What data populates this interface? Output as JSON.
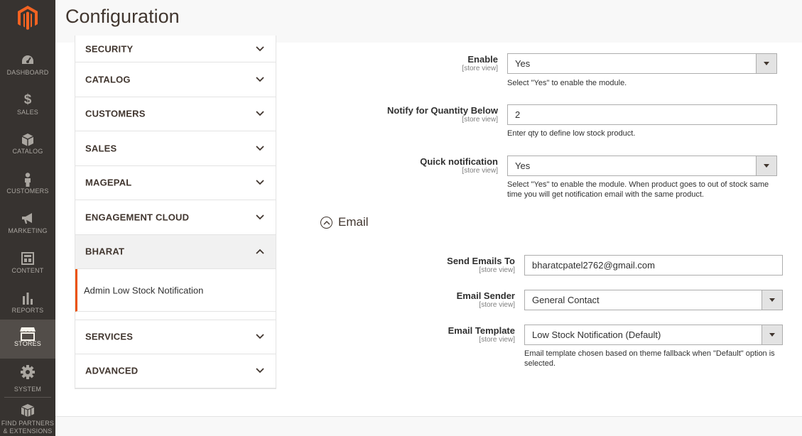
{
  "header": {
    "title": "Configuration"
  },
  "nav": {
    "items": [
      {
        "label": "DASHBOARD",
        "icon": "dashboard-icon"
      },
      {
        "label": "SALES",
        "icon": "dollar-icon"
      },
      {
        "label": "CATALOG",
        "icon": "box-icon"
      },
      {
        "label": "CUSTOMERS",
        "icon": "person-icon"
      },
      {
        "label": "MARKETING",
        "icon": "megaphone-icon"
      },
      {
        "label": "CONTENT",
        "icon": "layout-icon"
      },
      {
        "label": "REPORTS",
        "icon": "bar-chart-icon"
      },
      {
        "label": "STORES",
        "icon": "store-icon"
      },
      {
        "label": "SYSTEM",
        "icon": "gear-icon"
      },
      {
        "label": "FIND PARTNERS & EXTENSIONS",
        "icon": "cubes-icon"
      }
    ],
    "active": "STORES"
  },
  "tabs": {
    "items": [
      "SECURITY",
      "CATALOG",
      "CUSTOMERS",
      "SALES",
      "MAGEPAL",
      "ENGAGEMENT CLOUD",
      "BHARAT",
      "SERVICES",
      "ADVANCED"
    ],
    "open": "BHARAT",
    "sub_item": "Admin Low Stock Notification"
  },
  "form": {
    "scope_label": "[store view]",
    "enable": {
      "label": "Enable",
      "value": "Yes",
      "note": "Select \"Yes\" to enable the module."
    },
    "notify_qty": {
      "label": "Notify for Quantity Below",
      "value": "2",
      "note": "Enter qty to define low stock product."
    },
    "quick_notification": {
      "label": "Quick notification",
      "value": "Yes",
      "note": "Select \"Yes\" to enable the module. When product goes to out of stock same time you will get notification email with the same product."
    },
    "email_section": {
      "title": "Email",
      "state": "expanded"
    },
    "send_emails_to": {
      "label": "Send Emails To",
      "value": "bharatcpatel2762@gmail.com"
    },
    "email_sender": {
      "label": "Email Sender",
      "value": "General Contact"
    },
    "email_template": {
      "label": "Email Template",
      "value": "Low Stock Notification (Default)",
      "note": "Email template chosen based on theme fallback when \"Default\" option is selected."
    }
  },
  "colors": {
    "nav_bg": "#373330",
    "accent": "#eb5202",
    "logo": "#f26322"
  }
}
